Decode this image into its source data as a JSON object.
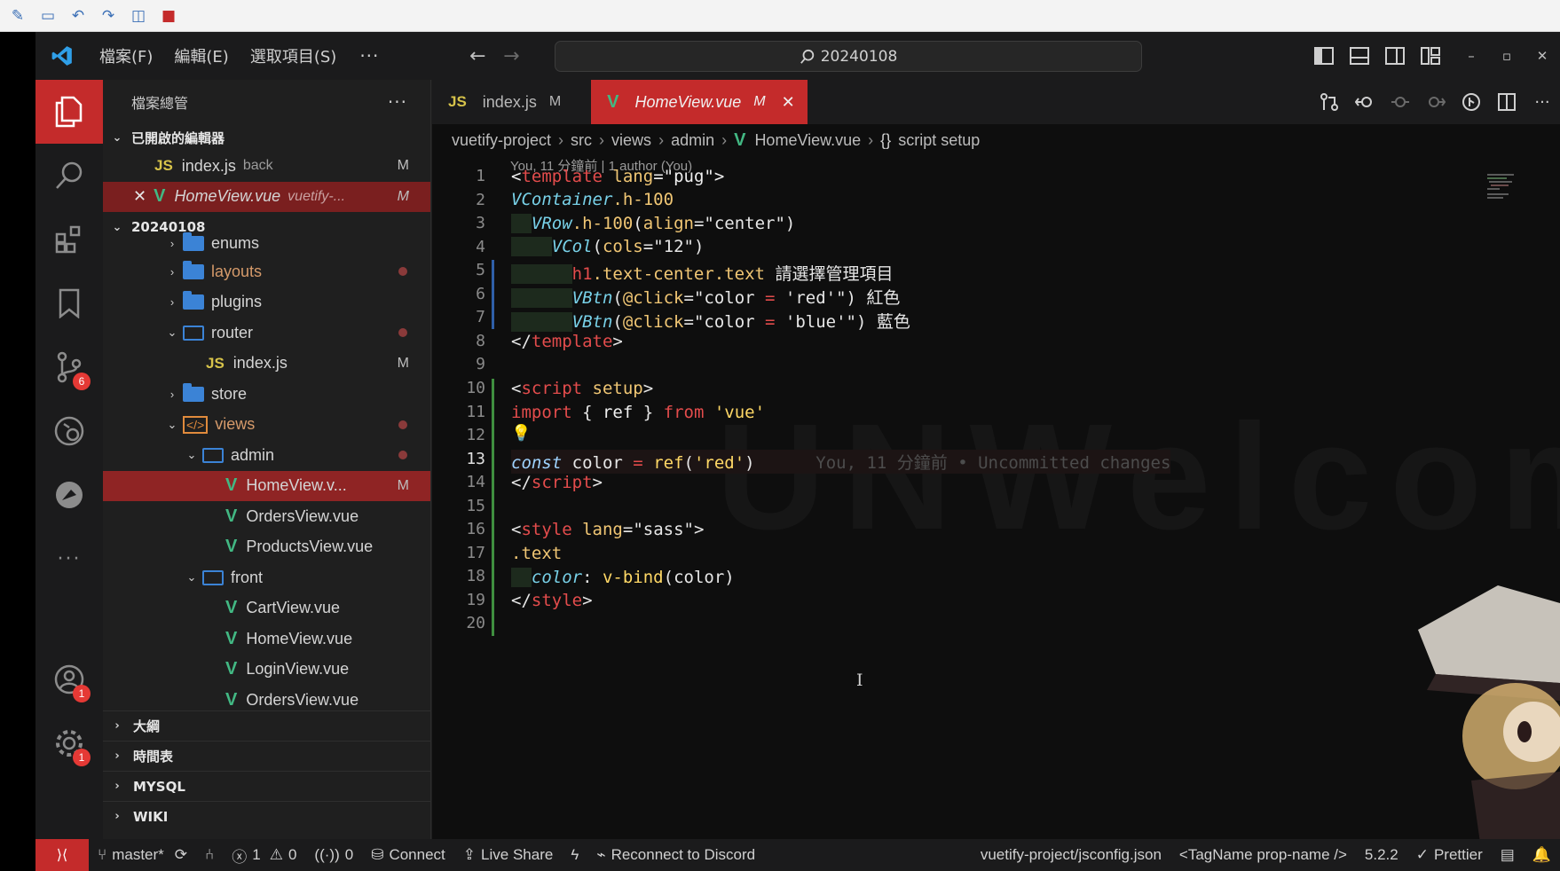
{
  "window": {
    "command_center": "20240108"
  },
  "menu": [
    "檔案(F)",
    "編輯(E)",
    "選取項目(S)"
  ],
  "sidebar": {
    "title": "檔案總管",
    "open_editors_label": "已開啟的編輯器",
    "open_editors": [
      {
        "name": "index.js",
        "desc": "back",
        "status": "M",
        "type": "js"
      },
      {
        "name": "HomeView.vue",
        "desc": "vuetify-...",
        "status": "M",
        "type": "vue"
      }
    ],
    "workspace_label": "20240108",
    "tree": [
      {
        "name": "enums",
        "type": "folder"
      },
      {
        "name": "layouts",
        "type": "folder"
      },
      {
        "name": "plugins",
        "type": "folder"
      },
      {
        "name": "router",
        "type": "folder-open"
      },
      {
        "name": "index.js",
        "type": "js",
        "status": "M"
      },
      {
        "name": "store",
        "type": "folder"
      },
      {
        "name": "views",
        "type": "views"
      },
      {
        "name": "admin",
        "type": "folder-open"
      },
      {
        "name": "HomeView.v...",
        "type": "vue",
        "status": "M"
      },
      {
        "name": "OrdersView.vue",
        "type": "vue"
      },
      {
        "name": "ProductsView.vue",
        "type": "vue"
      },
      {
        "name": "front",
        "type": "folder-open"
      },
      {
        "name": "CartView.vue",
        "type": "vue"
      },
      {
        "name": "HomeView.vue",
        "type": "vue"
      },
      {
        "name": "LoginView.vue",
        "type": "vue"
      },
      {
        "name": "OrdersView.vue",
        "type": "vue"
      }
    ],
    "panels": [
      "大綱",
      "時間表",
      "MYSQL",
      "WIKI"
    ]
  },
  "activity": {
    "scm_badge": "6",
    "accounts_badge": "1",
    "settings_badge": "1"
  },
  "tabs": [
    {
      "name": "index.js",
      "status": "M",
      "icon": "JS"
    },
    {
      "name": "HomeView.vue",
      "status": "M",
      "icon": "V"
    }
  ],
  "breadcrumb": [
    "vuetify-project",
    "src",
    "views",
    "admin",
    "HomeView.vue",
    "script setup"
  ],
  "editor": {
    "blame_header": "You, 11 分鐘前 | 1 author (You)",
    "inline_blame": "You, 11 分鐘前 • Uncommitted changes",
    "line_numbers": [
      "1",
      "2",
      "3",
      "4",
      "5",
      "6",
      "7",
      "8",
      "9",
      "10",
      "11",
      "12",
      "13",
      "14",
      "15",
      "16",
      "17",
      "18",
      "19",
      "20"
    ],
    "current_line": "13",
    "watermark": "UNWelcomeZ"
  },
  "statusbar": {
    "branch": "master*",
    "errors": "1",
    "warnings": "0",
    "ports": "0",
    "connect": "Connect",
    "live_share": "Live Share",
    "discord": "Reconnect to Discord",
    "jsconfig": "vuetify-project/jsconfig.json",
    "tagname": "<TagName prop-name />",
    "version": "5.2.2",
    "prettier": "Prettier"
  },
  "colors": {
    "accent": "#c42b2b",
    "background": "#0e0e0e",
    "vue": "#42b883",
    "js": "#d7c34a"
  }
}
